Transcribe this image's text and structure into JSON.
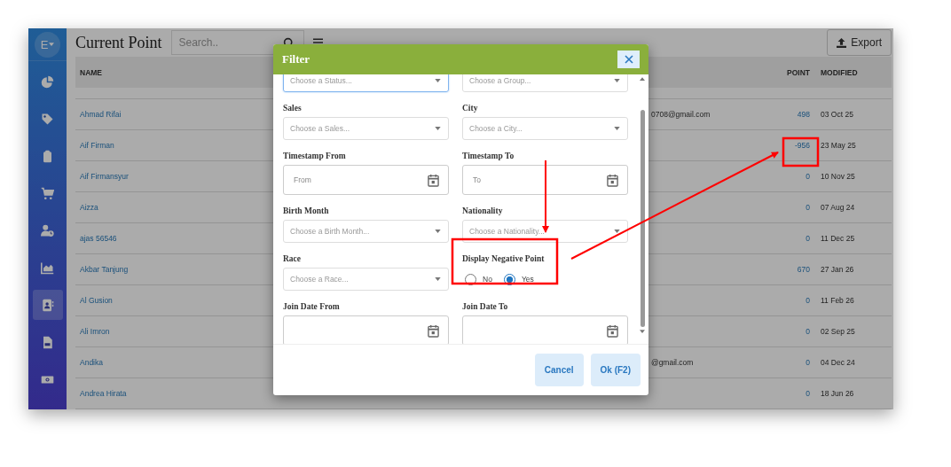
{
  "sidebar": {
    "avatar": "E",
    "items": [
      {
        "kind": "pie",
        "selected": false
      },
      {
        "kind": "tag",
        "selected": false
      },
      {
        "kind": "clipboard",
        "selected": false
      },
      {
        "kind": "cart",
        "selected": false
      },
      {
        "kind": "user-clock",
        "selected": false
      },
      {
        "kind": "chart",
        "selected": false
      },
      {
        "kind": "contacts",
        "selected": true
      },
      {
        "kind": "file",
        "selected": false
      },
      {
        "kind": "money",
        "selected": false
      }
    ]
  },
  "header": {
    "title": "Current Point",
    "search": {
      "placeholder": "Search.."
    },
    "export": "Export"
  },
  "table": {
    "columns": [
      "NAME",
      "POINT",
      "MODIFIED"
    ],
    "rows": [
      {
        "name": "Ahmad Rifai",
        "email": "0708@gmail.com",
        "point": "498",
        "modified": "03 Oct 25"
      },
      {
        "name": "Aif Firman",
        "point": "-956",
        "modified": "23 May 25"
      },
      {
        "name": "Aif Firmansyur",
        "point": "0",
        "modified": "10 Nov 25"
      },
      {
        "name": "Aizza",
        "point": "0",
        "modified": "07 Aug 24"
      },
      {
        "name": "ajas 56546",
        "point": "0",
        "modified": "11 Dec 25"
      },
      {
        "name": "Akbar Tanjung",
        "point": "670",
        "modified": "27 Jan 26"
      },
      {
        "name": "Al Gusion",
        "point": "0",
        "modified": "11 Feb 26"
      },
      {
        "name": "Ali Imron",
        "point": "0",
        "modified": "02 Sep 25"
      },
      {
        "name": "Andika",
        "email": "@gmail.com",
        "point": "0",
        "modified": "04 Dec 24"
      },
      {
        "name": "Andrea Hirata",
        "point": "0",
        "modified": "18 Jun 26"
      }
    ]
  },
  "modal": {
    "title": "Filter",
    "fields": [
      {
        "kind": "select",
        "placeholder": "Choose a Status...",
        "focused": true
      },
      {
        "kind": "select",
        "placeholder": "Choose a Group...",
        "focused": false
      },
      {
        "kind": "select",
        "label": "Sales",
        "placeholder": "Choose a Sales...",
        "focused": false
      },
      {
        "kind": "select",
        "label": "City",
        "placeholder": "Choose a City...",
        "focused": false
      },
      {
        "kind": "date",
        "label": "Timestamp From",
        "placeholder": "From",
        "focused": false
      },
      {
        "kind": "date",
        "label": "Timestamp To",
        "placeholder": "To",
        "focused": false
      },
      {
        "kind": "select",
        "label": "Birth Month",
        "placeholder": "Choose a Birth Month...",
        "focused": false
      },
      {
        "kind": "select",
        "label": "Nationality",
        "placeholder": "Choose a Nationality...",
        "focused": false
      },
      {
        "kind": "select",
        "label": "Race",
        "placeholder": "Choose a Race...",
        "focused": false
      },
      {
        "kind": "radio",
        "label": "Display Negative Point",
        "options": [
          {
            "label": "No",
            "selected": false
          },
          {
            "label": "Yes",
            "selected": true
          }
        ]
      },
      {
        "kind": "date",
        "label": "Join Date From",
        "focused": false
      },
      {
        "kind": "date",
        "label": "Join Date To",
        "focused": false
      }
    ],
    "buttons": [
      "Cancel",
      "Ok (F2)"
    ]
  }
}
